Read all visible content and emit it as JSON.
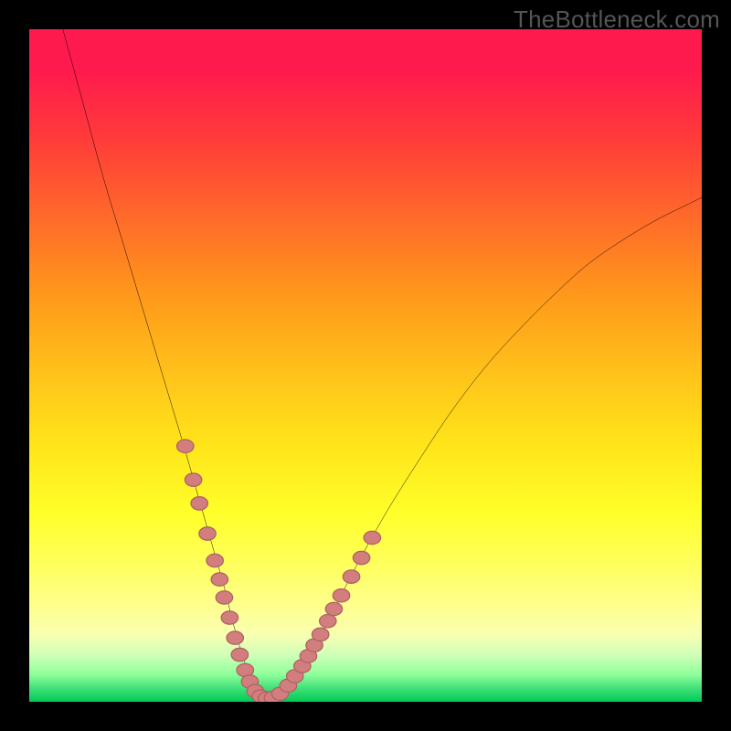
{
  "watermark": "TheBottleneck.com",
  "colors": {
    "background": "#000000",
    "curve": "#000000",
    "dot_fill": "#d37e7e",
    "dot_stroke": "#b06262",
    "gradient_top": "#ff1a4d",
    "gradient_bottom": "#00cc55"
  },
  "chart_data": {
    "type": "line",
    "title": "",
    "xlabel": "",
    "ylabel": "",
    "xlim": [
      0,
      100
    ],
    "ylim": [
      0,
      100
    ],
    "grid": false,
    "legend": false,
    "series": [
      {
        "name": "v-curve",
        "x": [
          5,
          8,
          11,
          14,
          17,
          20,
          23,
          25,
          27,
          29,
          30.5,
          32,
          33.5,
          35,
          37,
          40,
          44,
          48,
          53,
          58,
          63,
          68,
          73,
          78,
          83,
          88,
          93,
          98,
          100
        ],
        "y": [
          100,
          89,
          78,
          68,
          58,
          48,
          38,
          31,
          24,
          17,
          11,
          6,
          2.5,
          0.5,
          0.8,
          4,
          11,
          19,
          28,
          36,
          43.5,
          50,
          55.5,
          60.5,
          65,
          68.5,
          71.5,
          74,
          75
        ]
      }
    ],
    "dots": [
      {
        "x": 23.2,
        "y": 38.0
      },
      {
        "x": 24.4,
        "y": 33.0
      },
      {
        "x": 25.3,
        "y": 29.5
      },
      {
        "x": 26.5,
        "y": 25.0
      },
      {
        "x": 27.6,
        "y": 21.0
      },
      {
        "x": 28.3,
        "y": 18.2
      },
      {
        "x": 29.0,
        "y": 15.5
      },
      {
        "x": 29.8,
        "y": 12.5
      },
      {
        "x": 30.6,
        "y": 9.5
      },
      {
        "x": 31.3,
        "y": 7.0
      },
      {
        "x": 32.1,
        "y": 4.7
      },
      {
        "x": 32.8,
        "y": 3.0
      },
      {
        "x": 33.6,
        "y": 1.6
      },
      {
        "x": 34.4,
        "y": 0.8
      },
      {
        "x": 35.3,
        "y": 0.5
      },
      {
        "x": 36.2,
        "y": 0.6
      },
      {
        "x": 37.3,
        "y": 1.2
      },
      {
        "x": 38.5,
        "y": 2.4
      },
      {
        "x": 39.5,
        "y": 3.8
      },
      {
        "x": 40.6,
        "y": 5.3
      },
      {
        "x": 41.5,
        "y": 6.8
      },
      {
        "x": 42.4,
        "y": 8.4
      },
      {
        "x": 43.3,
        "y": 10.0
      },
      {
        "x": 44.4,
        "y": 12.0
      },
      {
        "x": 45.3,
        "y": 13.8
      },
      {
        "x": 46.4,
        "y": 15.8
      },
      {
        "x": 47.9,
        "y": 18.6
      },
      {
        "x": 49.4,
        "y": 21.4
      },
      {
        "x": 51.0,
        "y": 24.4
      }
    ],
    "dot_radius_pct": 1.25
  }
}
